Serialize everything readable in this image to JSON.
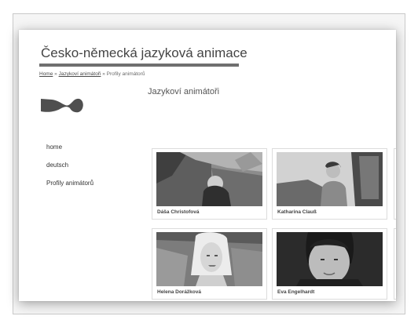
{
  "site": {
    "title": "Česko-německá jazyková animace"
  },
  "breadcrumb": {
    "items": [
      "Home",
      "Jazykoví animátoři"
    ],
    "separator": "»",
    "current": "Profily animátorů"
  },
  "page": {
    "heading": "Jazykoví animátoři"
  },
  "nav": {
    "items": [
      "home",
      "deutsch",
      "Profily animátorů"
    ]
  },
  "profiles": [
    {
      "name": "Dáša Christofová"
    },
    {
      "name": "Katharina Clauß"
    },
    {
      "name": "Helena Dorážková"
    },
    {
      "name": "Eva Engelhardt"
    }
  ],
  "colors": {
    "title_bar": "#6f6f6f",
    "text": "#444444"
  }
}
